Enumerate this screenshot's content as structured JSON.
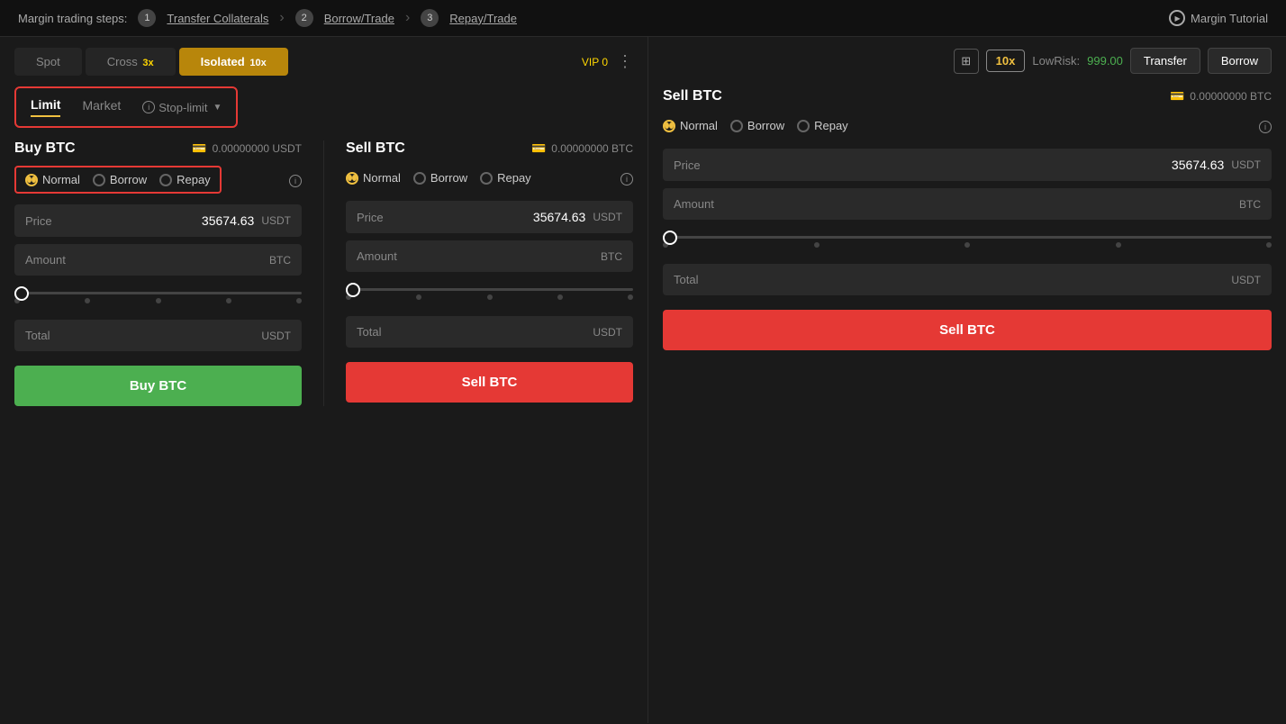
{
  "marginSteps": {
    "label": "Margin trading steps:",
    "step1": {
      "num": "1",
      "label": "Transfer Collaterals"
    },
    "step2": {
      "num": "2",
      "label": "Borrow/Trade"
    },
    "step3": {
      "num": "3",
      "label": "Repay/Trade"
    },
    "tutorial": "Margin Tutorial"
  },
  "tradingTabs": [
    {
      "label": "Spot",
      "active": false
    },
    {
      "label": "Cross",
      "leverage": "3x",
      "active": false
    },
    {
      "label": "Isolated",
      "leverage": "10x",
      "active": true
    }
  ],
  "vip": "VIP 0",
  "orderTypes": [
    {
      "label": "Limit",
      "active": true
    },
    {
      "label": "Market",
      "active": false
    },
    {
      "label": "Stop-limit",
      "active": false,
      "hasInfo": true,
      "hasDropdown": true
    }
  ],
  "rightControls": {
    "leverage": "10x",
    "lowriskLabel": "LowRisk:",
    "lowriskValue": "999.00",
    "transferLabel": "Transfer",
    "borrowLabel": "Borrow"
  },
  "buyPanel": {
    "title": "Buy BTC",
    "balance": "0.00000000 USDT",
    "orderModes": [
      {
        "label": "Normal",
        "selected": true
      },
      {
        "label": "Borrow",
        "selected": false
      },
      {
        "label": "Repay",
        "selected": false
      }
    ],
    "priceLabel": "Price",
    "priceValue": "35674.63",
    "priceCurrency": "USDT",
    "amountLabel": "Amount",
    "amountCurrency": "BTC",
    "totalLabel": "Total",
    "totalCurrency": "USDT",
    "buttonLabel": "Buy BTC"
  },
  "sellPanel": {
    "title": "Sell BTC",
    "balance": "0.00000000 BTC",
    "orderModes": [
      {
        "label": "Normal",
        "selected": true
      },
      {
        "label": "Borrow",
        "selected": false
      },
      {
        "label": "Repay",
        "selected": false
      }
    ],
    "priceLabel": "Price",
    "priceValue": "35674.63",
    "priceCurrency": "USDT",
    "amountLabel": "Amount",
    "amountCurrency": "BTC",
    "totalLabel": "Total",
    "totalCurrency": "USDT",
    "buttonLabel": "Sell BTC"
  }
}
